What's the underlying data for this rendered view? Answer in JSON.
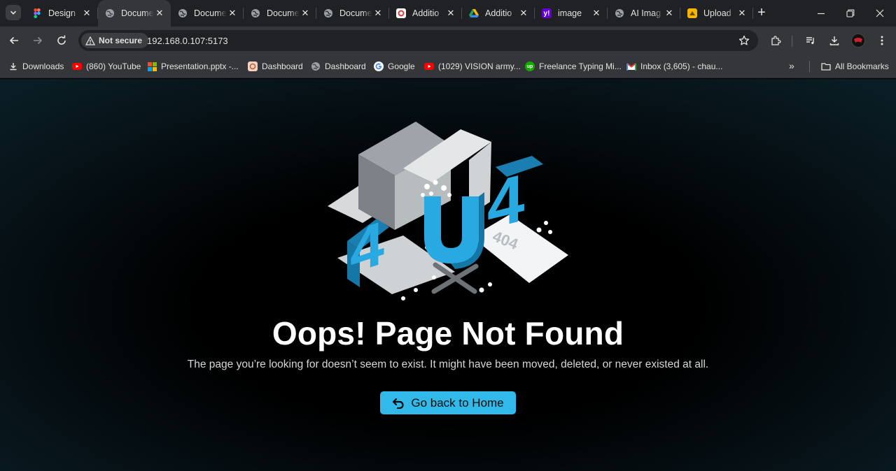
{
  "browser": {
    "tabs": [
      {
        "title": "Design",
        "icon": "figma-icon",
        "color": "#a259ff"
      },
      {
        "title": "Document",
        "icon": "globe-icon",
        "color": "#9aa0a6",
        "active": true
      },
      {
        "title": "Document",
        "icon": "globe-icon",
        "color": "#9aa0a6"
      },
      {
        "title": "Document",
        "icon": "globe-icon",
        "color": "#9aa0a6"
      },
      {
        "title": "Document",
        "icon": "globe-icon",
        "color": "#9aa0a6"
      },
      {
        "title": "Additio",
        "icon": "app-icon",
        "color": "#e53935"
      },
      {
        "title": "Additio",
        "icon": "google-drive-icon",
        "color": "#1fa463"
      },
      {
        "title": "image",
        "icon": "yahoo-icon",
        "color": "#6001d2"
      },
      {
        "title": "AI Imag",
        "icon": "globe-icon",
        "color": "#9aa0a6"
      },
      {
        "title": "Upload",
        "icon": "upload-app-icon",
        "color": "#f5b400"
      }
    ],
    "security_label": "Not secure",
    "url": "192.168.0.107:5173",
    "bookmarks": [
      {
        "label": "Downloads",
        "icon": "download-icon"
      },
      {
        "label": "(860) YouTube",
        "icon": "youtube-icon"
      },
      {
        "label": "Presentation.pptx -...",
        "icon": "microsoft-icon"
      },
      {
        "label": "Dashboard",
        "icon": "dashboard-app-icon"
      },
      {
        "label": "Dashboard",
        "icon": "globe-icon"
      },
      {
        "label": "Google",
        "icon": "google-icon"
      },
      {
        "label": "(1029) VISION army...",
        "icon": "youtube-icon"
      },
      {
        "label": "Freelance Typing Mi...",
        "icon": "upwork-icon"
      },
      {
        "label": "Inbox (3,605) - chau...",
        "icon": "gmail-icon"
      }
    ],
    "all_bookmarks_label": "All Bookmarks"
  },
  "page": {
    "illustration_text": [
      "4",
      "0",
      "4"
    ],
    "paper_text": "404",
    "title": "Oops! Page Not Found",
    "subtitle": "The page you’re looking for doesn’t seem to exist. It might have been moved, deleted, or never existed at all.",
    "button_label": "Go back to Home",
    "accent_color": "#31b9ea"
  }
}
